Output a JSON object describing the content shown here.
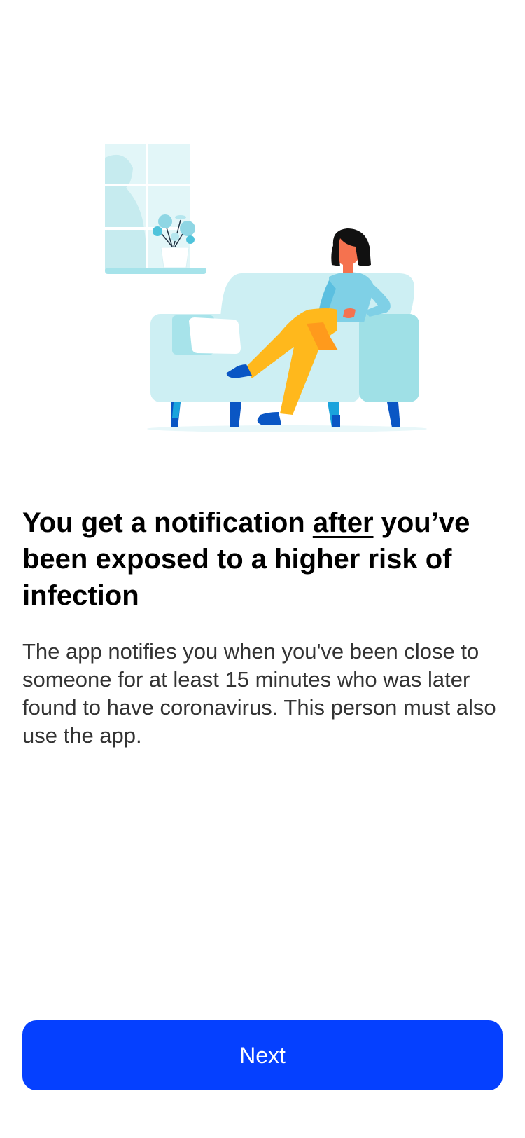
{
  "onboarding": {
    "title_before": "You get a notification ",
    "title_emphasis": "after",
    "title_after": " you’ve been exposed to a higher risk of infection",
    "body": "The app notifies you when you've been close to someone for at least 15 minutes who was later found to have coronavirus. This person must also use the app.",
    "next_label": "Next"
  },
  "colors": {
    "accent": "#0540ff",
    "illustration_light": "#cdeff3",
    "illustration_mid": "#9fe0e6",
    "illustration_dark_blue": "#0a56c4",
    "pants": "#ffb81c",
    "skin": "#f5724f",
    "shirt": "#7fd0e6"
  },
  "icons": {
    "illustration": "woman-on-sofa-illustration"
  }
}
